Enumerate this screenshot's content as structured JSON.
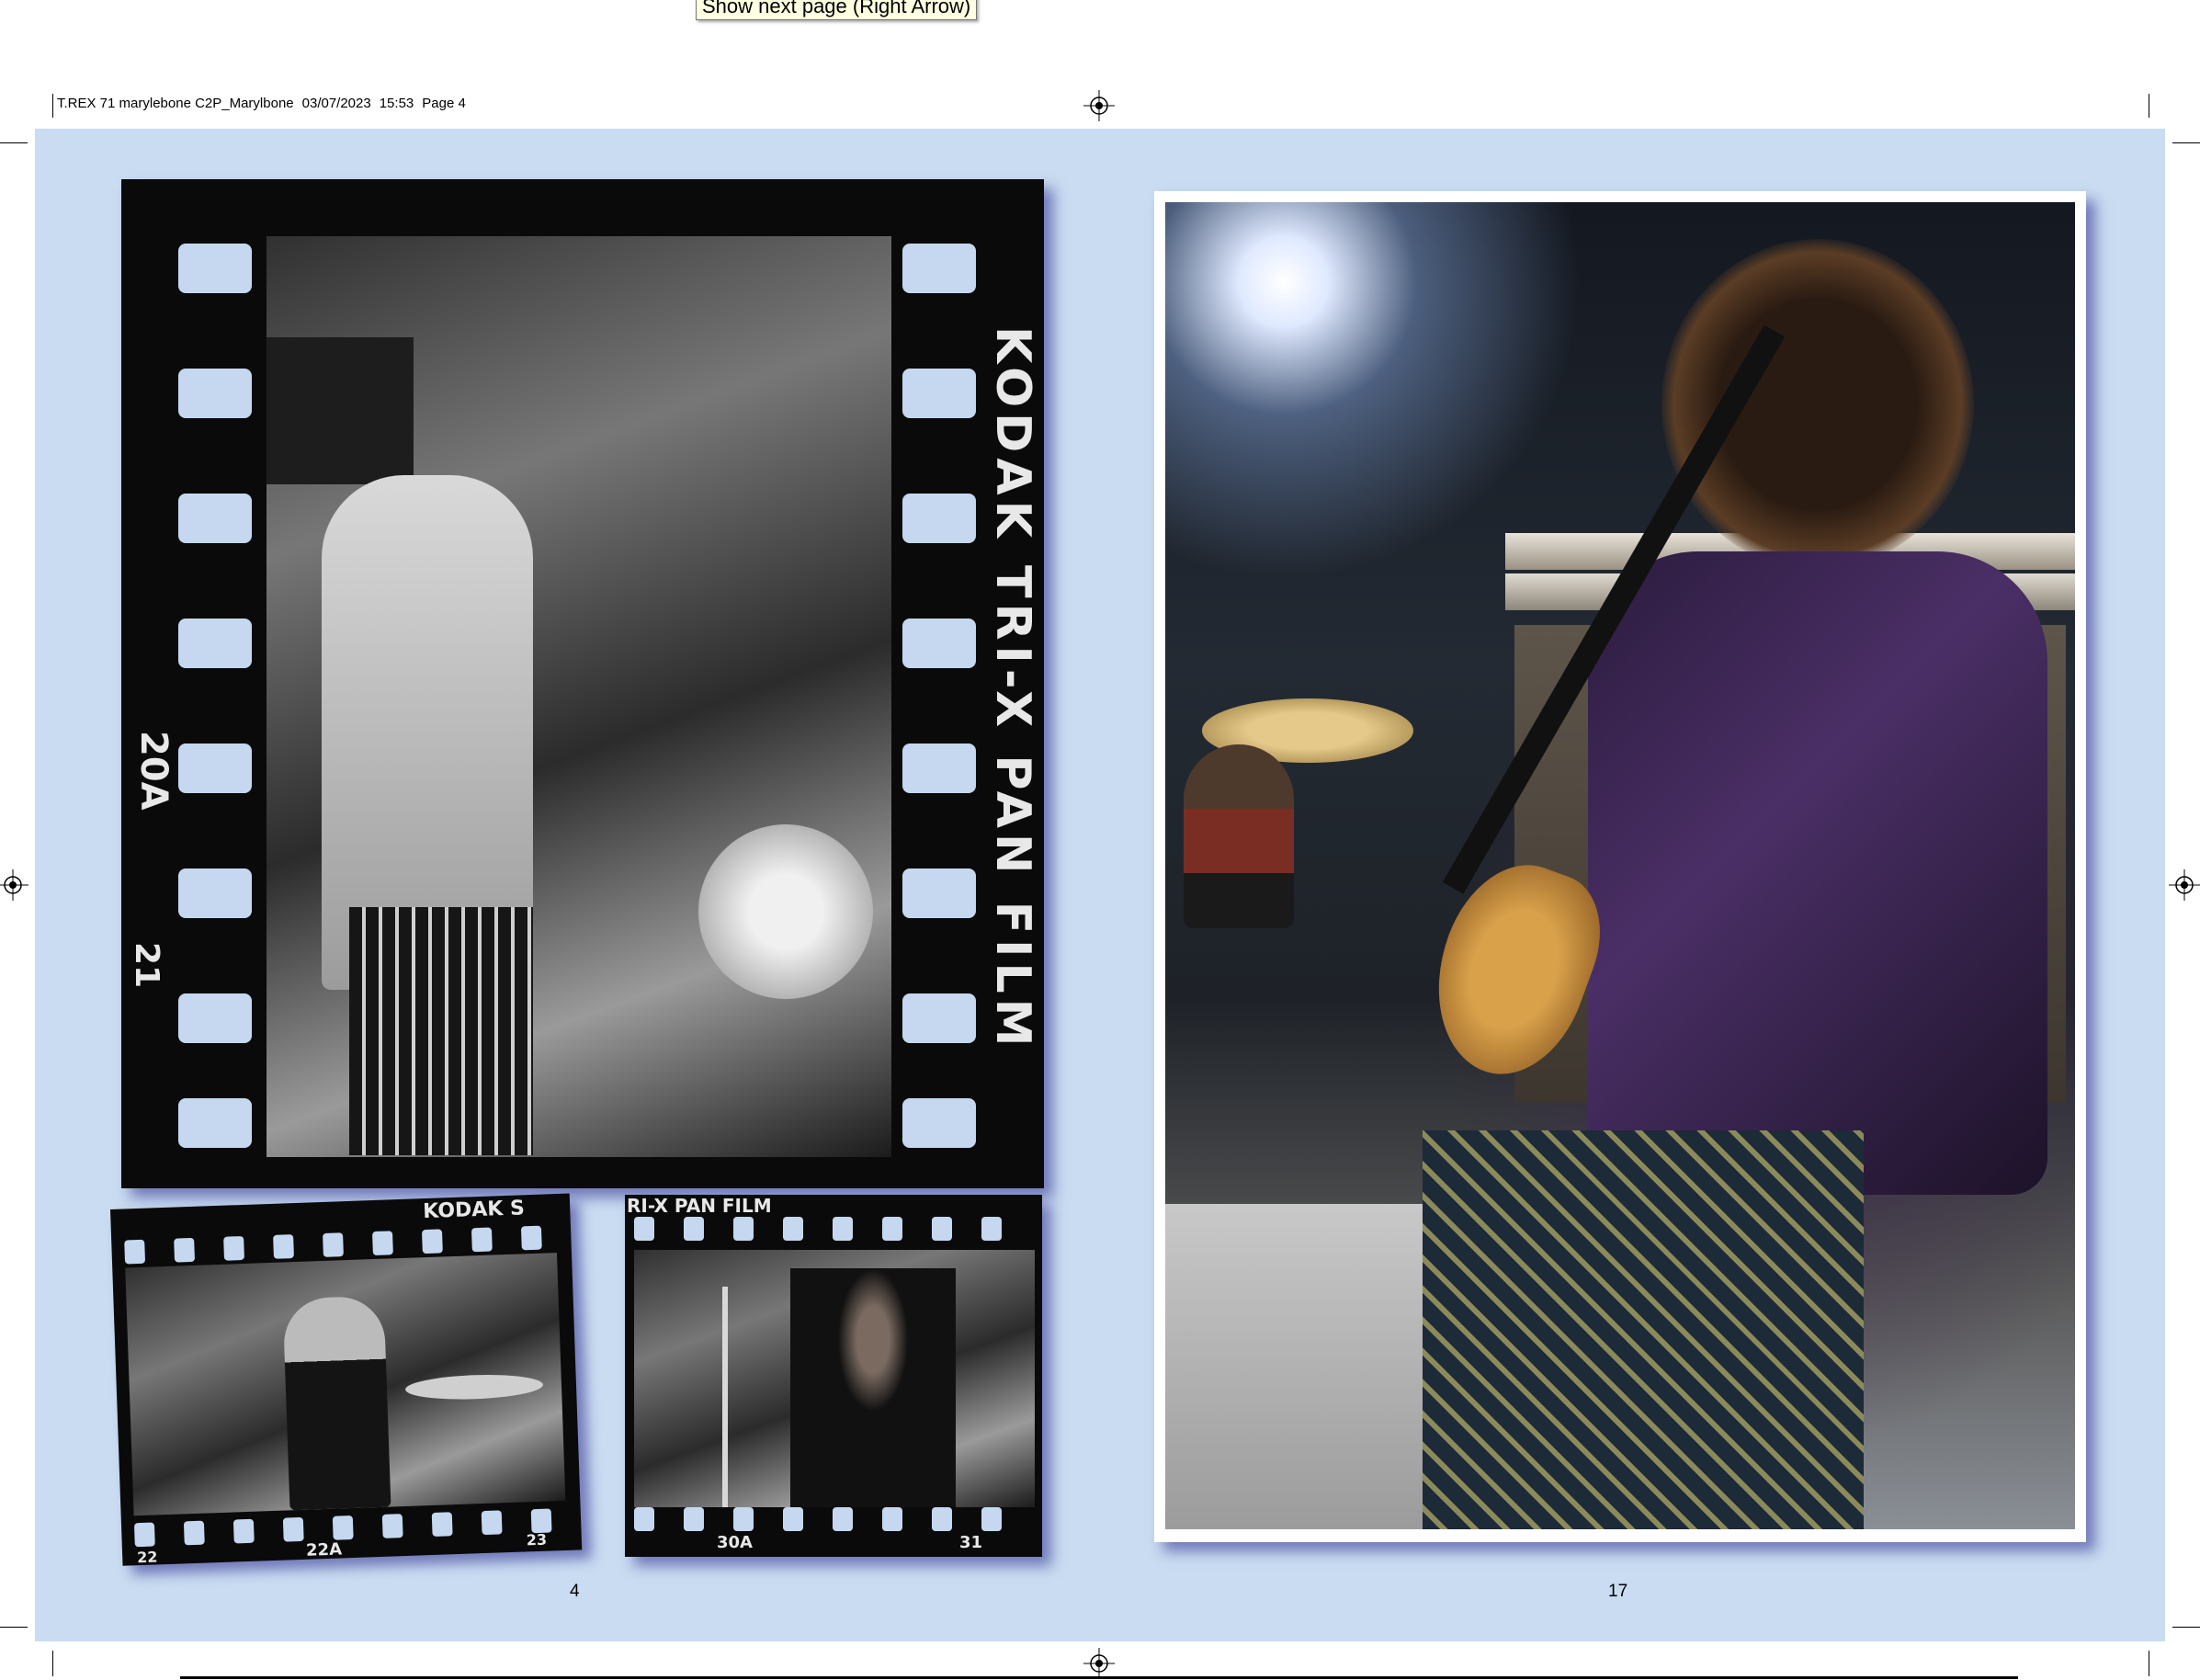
{
  "tooltip": {
    "text": "Show next page (Right Arrow)"
  },
  "slug": {
    "job": "T.REX 71 marylebone C2P_Marylbone",
    "date": "03/07/2023",
    "time": "15:53",
    "page": "Page 4"
  },
  "left_page": {
    "page_number": "4",
    "main_film": {
      "edge_text": "KODAK TRI-X PAN FILM",
      "frame_a": "20A",
      "frame_b": "21"
    },
    "small_film_1": {
      "top_edge": "KODAK S",
      "frame_a": "22",
      "frame_b": "22A",
      "frame_c": "23"
    },
    "small_film_2": {
      "top_edge": "RI-X PAN FILM",
      "frame_a": "30A",
      "frame_b": "31"
    }
  },
  "right_page": {
    "page_number": "17"
  },
  "colors": {
    "spread_bg": "#c9dcf1",
    "film": "#0a0a0a",
    "tooltip_bg": "#ffffe1",
    "shadow": "#2a2a8c"
  }
}
